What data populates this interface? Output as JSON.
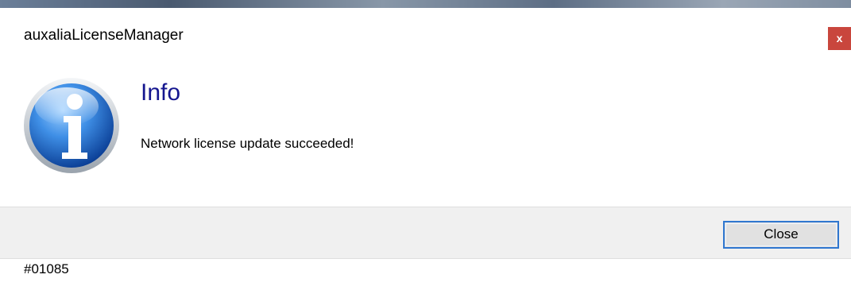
{
  "window": {
    "title": "auxaliaLicenseManager",
    "close_glyph": "x"
  },
  "dialog": {
    "icon": "info-icon",
    "heading": "Info",
    "message": "Network license update succeeded!"
  },
  "footer": {
    "close_label": "Close"
  },
  "status": {
    "code": "#01085"
  },
  "colors": {
    "heading": "#15168f",
    "close_x_bg": "#c9463d",
    "button_border": "#2f77d0",
    "footer_bg": "#f0f0f0"
  }
}
